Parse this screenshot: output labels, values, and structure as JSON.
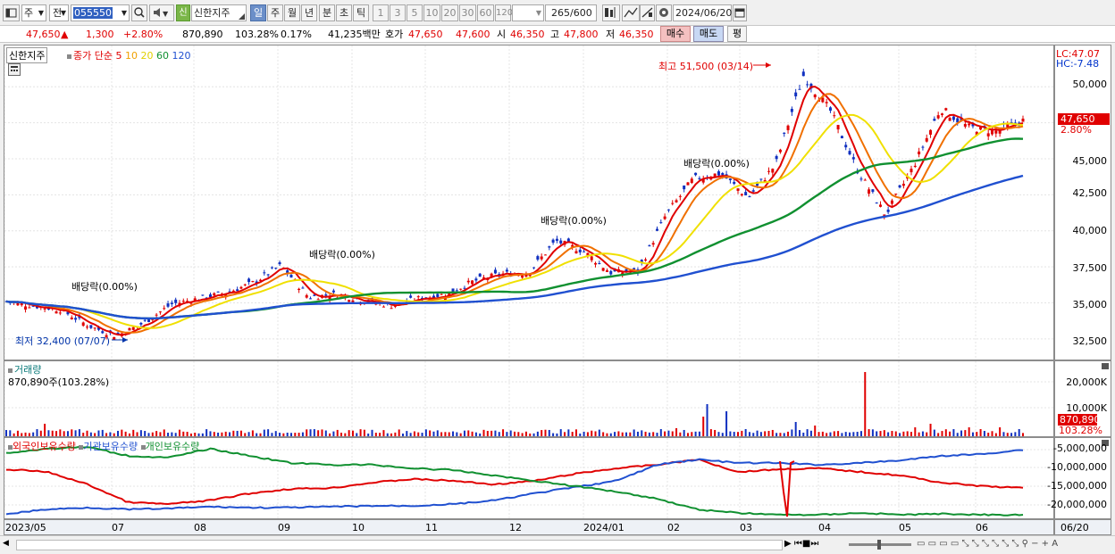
{
  "toolbar": {
    "market": "주",
    "market2": "전",
    "code": "055550",
    "badge": "신",
    "name": "신한지주",
    "periods": [
      "일",
      "주",
      "월",
      "년",
      "분",
      "초",
      "틱"
    ],
    "numbers": [
      "1",
      "3",
      "5",
      "10",
      "20",
      "30",
      "60",
      "120"
    ],
    "count": "265",
    "count_max": "/600",
    "date": "2024/06/20"
  },
  "info": {
    "price": "47,650",
    "arrow": "▲",
    "change": "1,300",
    "rate": "+2.80%",
    "volume": "870,890",
    "vol_rate": "103.28%",
    "turnover": "0.17%",
    "amount": "41,235백만",
    "hoga_label": "호가",
    "ask": "47,650",
    "bid": "47,600",
    "open_label": "시",
    "open": "46,350",
    "high_label": "고",
    "high": "47,800",
    "low_label": "저",
    "low": "46,350",
    "buy": "매수",
    "sell": "매도",
    "eval": "평"
  },
  "price_pane": {
    "legend_name": "신한지주",
    "legend_ma_label": "종가 단순",
    "ma_periods": [
      "5",
      "10",
      "20",
      "60",
      "120"
    ],
    "ma_colors": [
      "#e00000",
      "#f07000",
      "#f0e000",
      "#109030",
      "#2050d0"
    ],
    "lc": "LC:47.07",
    "hc": "HC:-7.48",
    "y_ticks": [
      "50,000",
      "47,500",
      "45,000",
      "42,500",
      "40,000",
      "37,500",
      "35,000",
      "32,500"
    ],
    "cur_price": "47,650",
    "cur_rate": "2.80%",
    "annotations": {
      "high": "최고 51,500 (03/14)",
      "low": "최저 32,400 (07/07)",
      "div1": "배당락(0.00%)",
      "div2": "배당락(0.00%)",
      "div3": "배당락(0.00%)",
      "div4": "배당락(0.00%)"
    }
  },
  "volume_pane": {
    "title": "거래량",
    "value": "870,890주(103.28%)",
    "y_ticks": [
      "20,000K",
      "10,000K"
    ],
    "cur": "870,890",
    "cur_rate": "103.28%"
  },
  "holding_pane": {
    "legend": [
      "외국인보유수량",
      "기관보유수량",
      "개인보유수량"
    ],
    "colors": [
      "#e00000",
      "#2050d0",
      "#109030"
    ],
    "y_ticks": [
      "-5,000,000",
      "-10,000,000",
      "-15,000,000",
      "-20,000,000"
    ]
  },
  "x_axis": {
    "labels": [
      "2023/05",
      "07",
      "08",
      "09",
      "10",
      "11",
      "12",
      "2024/01",
      "02",
      "03",
      "04",
      "05",
      "06"
    ],
    "end": "06/20"
  },
  "chart_data": {
    "type": "candlestick",
    "ylim": [
      31500,
      52000
    ],
    "annotations": {
      "high": [
        51500
      ],
      "low": [
        32400
      ]
    },
    "close_approx": [
      35100,
      34800,
      34500,
      33400,
      32700,
      33600,
      34900,
      35300,
      35700,
      36400,
      37600,
      35400,
      35600,
      35200,
      34800,
      35300,
      35600,
      36500,
      37000,
      37100,
      39300,
      38600,
      37100,
      37200,
      41100,
      43600,
      44000,
      42300,
      44600,
      50800,
      48300,
      44100,
      41100,
      44400,
      48500,
      47200,
      46900,
      47650
    ]
  }
}
